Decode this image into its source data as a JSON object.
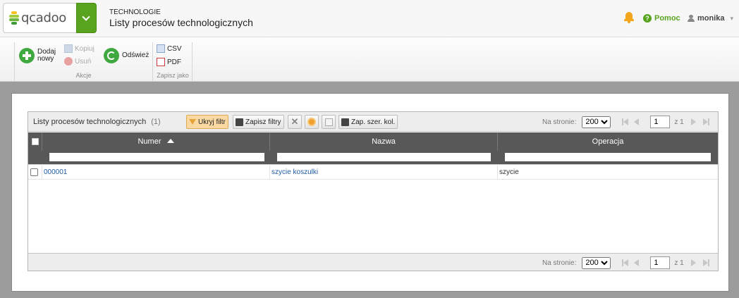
{
  "app": {
    "logo_text": "qcadoo",
    "section": "TECHNOLOGIE",
    "page_title": "Listy procesów technologicznych"
  },
  "header": {
    "help_label": "Pomoc",
    "user_name": "monika",
    "colors": {
      "brand_green": "#59a41e",
      "bell": "#f3a51b"
    }
  },
  "ribbon": {
    "actions": {
      "label": "Akcje",
      "add_label_1": "Dodaj",
      "add_label_2": "nowy",
      "copy_label": "Kopiuj",
      "delete_label": "Usuń",
      "refresh_label": "Odśwież"
    },
    "export": {
      "label": "Zapisz jako",
      "csv_label": "CSV",
      "pdf_label": "PDF"
    }
  },
  "grid": {
    "title": "Listy procesów technologicznych",
    "count": "(1)",
    "toolbar": {
      "hide_filter": "Ukryj filtr",
      "save_filters": "Zapisz filtry",
      "save_widths": "Zap. szer. kol."
    },
    "pager": {
      "per_page_label": "Na stronie:",
      "per_page_value": "200",
      "per_page_options": [
        "200"
      ],
      "current_page": "1",
      "of_label": "z 1"
    },
    "columns": [
      "Numer",
      "Nazwa",
      "Operacja"
    ],
    "rows": [
      {
        "number": "000001",
        "name": "szycie koszulki",
        "operation": "szycie"
      }
    ]
  }
}
